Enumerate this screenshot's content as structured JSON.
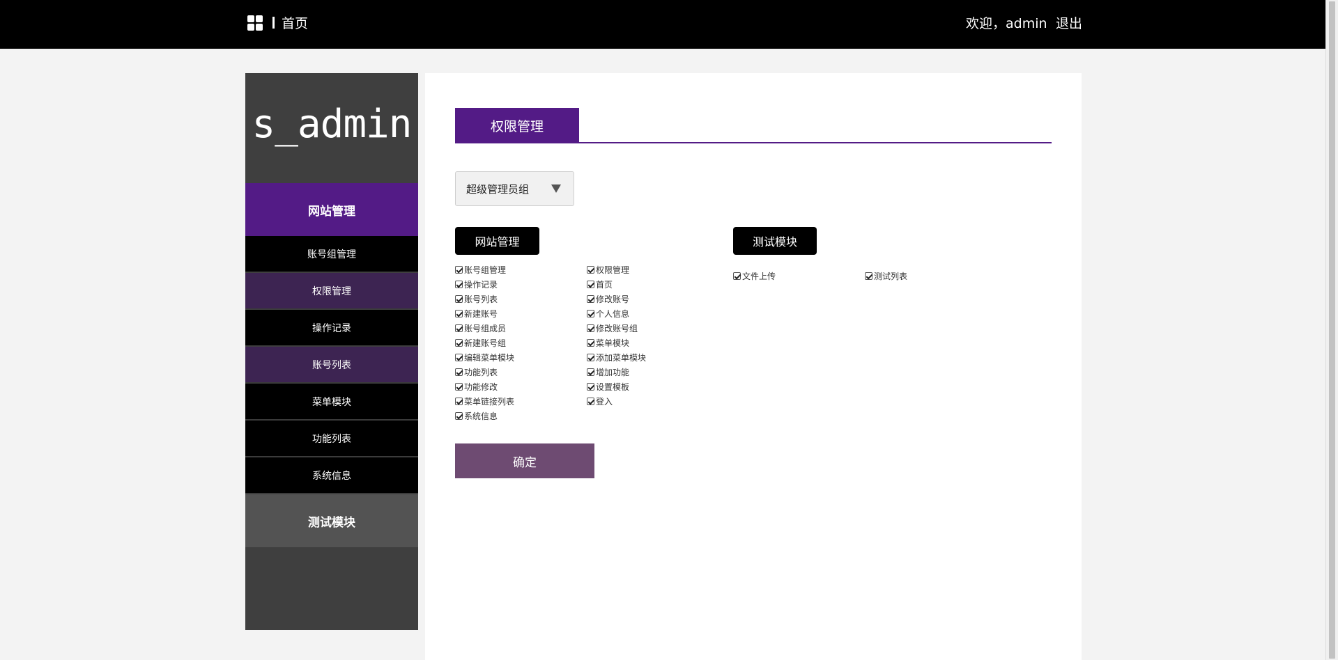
{
  "topbar": {
    "logo_icon": "grid-icon",
    "home_label": "首页",
    "welcome_text": "欢迎，admin",
    "logout_label": "退出"
  },
  "sidebar": {
    "brand": "s_admin",
    "groups": [
      {
        "label": "网站管理",
        "active": true
      },
      {
        "label": "测试模块",
        "active": false
      }
    ],
    "items": [
      {
        "label": "账号组管理"
      },
      {
        "label": "权限管理"
      },
      {
        "label": "操作记录"
      },
      {
        "label": "账号列表"
      },
      {
        "label": "菜单模块"
      },
      {
        "label": "功能列表"
      },
      {
        "label": "系统信息"
      }
    ]
  },
  "main": {
    "title": "权限管理",
    "group_select": {
      "value": "超级管理员组"
    },
    "modules": [
      {
        "label": "网站管理",
        "permissions": [
          "账号组管理",
          "权限管理",
          "操作记录",
          "首页",
          "账号列表",
          "修改账号",
          "新建账号",
          "个人信息",
          "账号组成员",
          "修改账号组",
          "新建账号组",
          "菜单模块",
          "编辑菜单模块",
          "添加菜单模块",
          "功能列表",
          "增加功能",
          "功能修改",
          "设置模板",
          "菜单链接列表",
          "登入",
          "系统信息"
        ]
      },
      {
        "label": "测试模块",
        "permissions": [
          "文件上传",
          "测试列表"
        ]
      }
    ],
    "submit_label": "确定"
  },
  "colors": {
    "accent": "#531b86",
    "topbar": "#000000",
    "sidebar_bg": "#3f3f3f",
    "submit": "#6e4b72"
  }
}
